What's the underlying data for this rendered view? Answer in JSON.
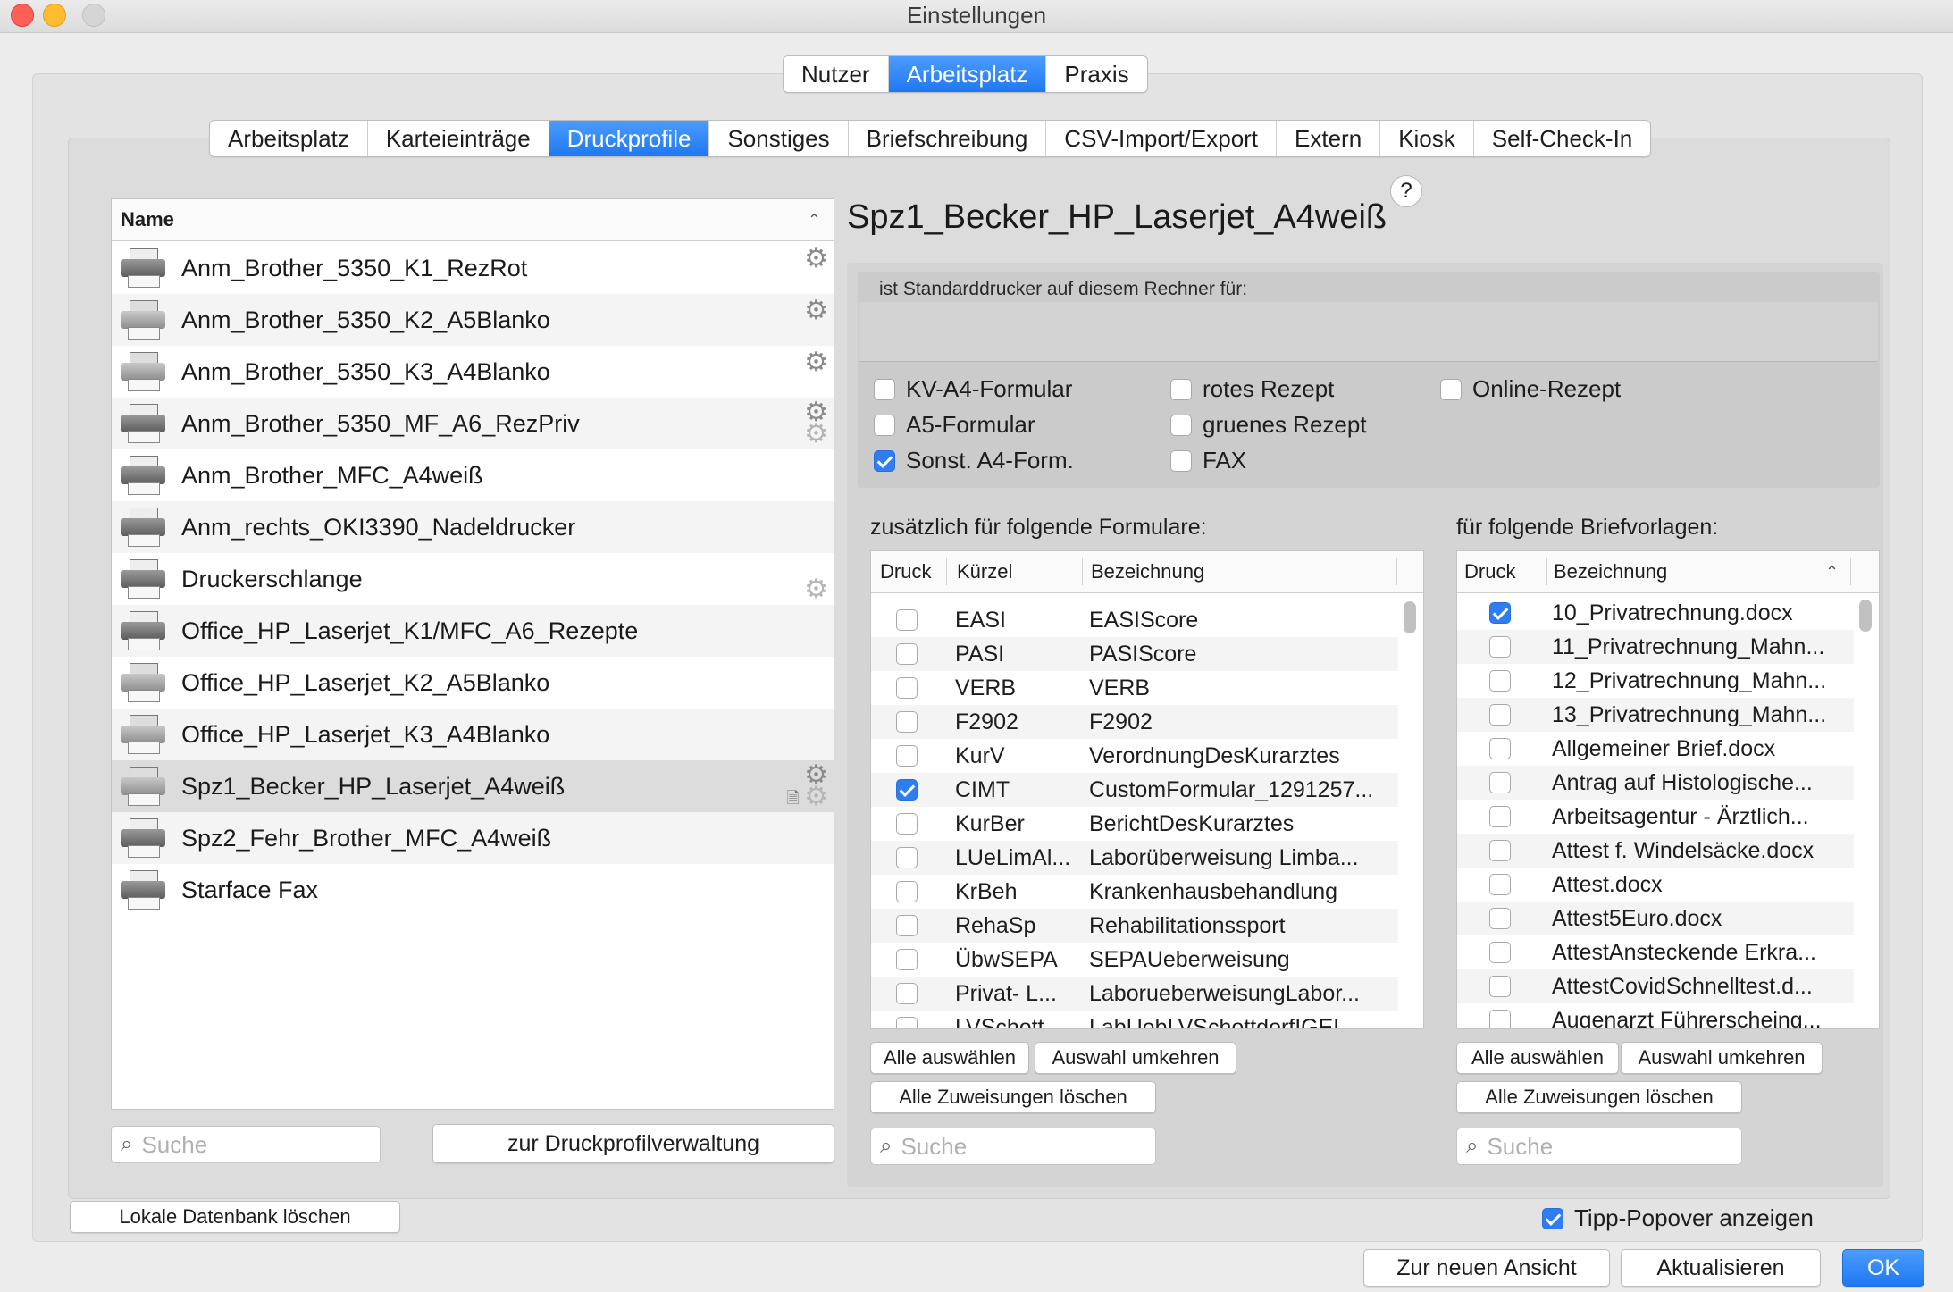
{
  "window": {
    "title": "Einstellungen"
  },
  "top_tabs": [
    {
      "label": "Nutzer",
      "active": false
    },
    {
      "label": "Arbeitsplatz",
      "active": true
    },
    {
      "label": "Praxis",
      "active": false
    }
  ],
  "sub_tabs": [
    {
      "label": "Arbeitsplatz",
      "active": false
    },
    {
      "label": "Karteieinträge",
      "active": false
    },
    {
      "label": "Druckprofile",
      "active": true
    },
    {
      "label": "Sonstiges",
      "active": false
    },
    {
      "label": "Briefschreibung",
      "active": false
    },
    {
      "label": "CSV-Import/Export",
      "active": false
    },
    {
      "label": "Extern",
      "active": false
    },
    {
      "label": "Kiosk",
      "active": false
    },
    {
      "label": "Self-Check-In",
      "active": false
    }
  ],
  "profile_list": {
    "header": "Name",
    "items": [
      {
        "name": "Anm_Brother_5350_K1_RezRot",
        "icon": "printer-icon",
        "badge": "gear"
      },
      {
        "name": "Anm_Brother_5350_K2_A5Blanko",
        "icon": "printer-gray-icon",
        "badge": "gear"
      },
      {
        "name": "Anm_Brother_5350_K3_A4Blanko",
        "icon": "printer-gray-icon",
        "badge": "gear"
      },
      {
        "name": "Anm_Brother_5350_MF_A6_RezPriv",
        "icon": "printer-icon",
        "badge": "gear-double"
      },
      {
        "name": "Anm_Brother_MFC_A4weiß",
        "icon": "printer-icon",
        "badge": ""
      },
      {
        "name": "Anm_rechts_OKI3390_Nadeldrucker",
        "icon": "printer-icon",
        "badge": ""
      },
      {
        "name": "Druckerschlange",
        "icon": "printer-icon",
        "badge": "gear-light"
      },
      {
        "name": "Office_HP_Laserjet_K1/MFC_A6_Rezepte",
        "icon": "printer-icon",
        "badge": ""
      },
      {
        "name": "Office_HP_Laserjet_K2_A5Blanko",
        "icon": "printer-gray-icon",
        "badge": ""
      },
      {
        "name": "Office_HP_Laserjet_K3_A4Blanko",
        "icon": "printer-gray-icon",
        "badge": ""
      },
      {
        "name": "Spz1_Becker_HP_Laserjet_A4weiß",
        "icon": "printer-gray-icon",
        "badge": "gear-doc",
        "selected": true
      },
      {
        "name": "Spz2_Fehr_Brother_MFC_A4weiß",
        "icon": "printer-icon",
        "badge": ""
      },
      {
        "name": "Starface Fax",
        "icon": "printer-icon",
        "badge": ""
      }
    ],
    "search_placeholder": "Suche",
    "manage_button": "zur Druckprofilverwaltung"
  },
  "detail": {
    "title": "Spz1_Becker_HP_Laserjet_A4weiß",
    "help": "?",
    "standard_label": "ist Standarddrucker auf diesem Rechner für:",
    "standard_options": [
      {
        "label": "KV-A4-Formular",
        "checked": false
      },
      {
        "label": "A5-Formular",
        "checked": false
      },
      {
        "label": "Sonst. A4-Form.",
        "checked": true
      },
      {
        "label": "rotes Rezept",
        "checked": false
      },
      {
        "label": "gruenes Rezept",
        "checked": false
      },
      {
        "label": "FAX",
        "checked": false
      },
      {
        "label": "Online-Rezept",
        "checked": false
      }
    ]
  },
  "forms": {
    "label": "zusätzlich für folgende Formulare:",
    "columns": [
      "Druck",
      "Kürzel",
      "Bezeichnung"
    ],
    "rows": [
      {
        "checked": false,
        "kuerzel": "EASI",
        "bezeichnung": "EASIScore"
      },
      {
        "checked": false,
        "kuerzel": "PASI",
        "bezeichnung": "PASIScore"
      },
      {
        "checked": false,
        "kuerzel": "VERB",
        "bezeichnung": "VERB"
      },
      {
        "checked": false,
        "kuerzel": "F2902",
        "bezeichnung": "F2902"
      },
      {
        "checked": false,
        "kuerzel": "KurV",
        "bezeichnung": "VerordnungDesKurarztes"
      },
      {
        "checked": true,
        "kuerzel": "CIMT",
        "bezeichnung": "CustomFormular_1291257..."
      },
      {
        "checked": false,
        "kuerzel": "KurBer",
        "bezeichnung": "BerichtDesKurarztes"
      },
      {
        "checked": false,
        "kuerzel": "LUeLimAl...",
        "bezeichnung": "Laborüberweisung Limba..."
      },
      {
        "checked": false,
        "kuerzel": "KrBeh",
        "bezeichnung": "Krankenhausbehandlung"
      },
      {
        "checked": false,
        "kuerzel": "RehaSp",
        "bezeichnung": "Rehabilitationssport"
      },
      {
        "checked": false,
        "kuerzel": "ÜbwSEPA",
        "bezeichnung": "SEPAUeberweisung"
      },
      {
        "checked": false,
        "kuerzel": "Privat- L...",
        "bezeichnung": "LaborueberweisungLabor..."
      },
      {
        "checked": false,
        "kuerzel": "LVSchott",
        "bezeichnung": "LabUebLVSchottdorfIGEL"
      }
    ],
    "select_all": "Alle auswählen",
    "invert": "Auswahl umkehren",
    "clear": "Alle Zuweisungen löschen",
    "search_placeholder": "Suche"
  },
  "letters": {
    "label": "für folgende Briefvorlagen:",
    "columns": [
      "Druck",
      "Bezeichnung"
    ],
    "rows": [
      {
        "checked": true,
        "bezeichnung": "10_Privatrechnung.docx"
      },
      {
        "checked": false,
        "bezeichnung": "11_Privatrechnung_Mahn..."
      },
      {
        "checked": false,
        "bezeichnung": "12_Privatrechnung_Mahn..."
      },
      {
        "checked": false,
        "bezeichnung": "13_Privatrechnung_Mahn..."
      },
      {
        "checked": false,
        "bezeichnung": "Allgemeiner Brief.docx"
      },
      {
        "checked": false,
        "bezeichnung": "Antrag auf Histologische..."
      },
      {
        "checked": false,
        "bezeichnung": "Arbeitsagentur - Ärztlich..."
      },
      {
        "checked": false,
        "bezeichnung": "Attest f. Windelsäcke.docx"
      },
      {
        "checked": false,
        "bezeichnung": "Attest.docx"
      },
      {
        "checked": false,
        "bezeichnung": "Attest5Euro.docx"
      },
      {
        "checked": false,
        "bezeichnung": "AttestAnsteckende Erkra..."
      },
      {
        "checked": false,
        "bezeichnung": "AttestCovidSchnelltest.d..."
      },
      {
        "checked": false,
        "bezeichnung": "Augenarzt Führerscheing..."
      }
    ],
    "select_all": "Alle auswählen",
    "invert": "Auswahl umkehren",
    "clear": "Alle Zuweisungen löschen",
    "search_placeholder": "Suche"
  },
  "footer": {
    "delete_db": "Lokale Datenbank löschen",
    "tip_popover": {
      "label": "Tipp-Popover anzeigen",
      "checked": true
    },
    "new_view": "Zur neuen Ansicht",
    "refresh": "Aktualisieren",
    "ok": "OK"
  }
}
